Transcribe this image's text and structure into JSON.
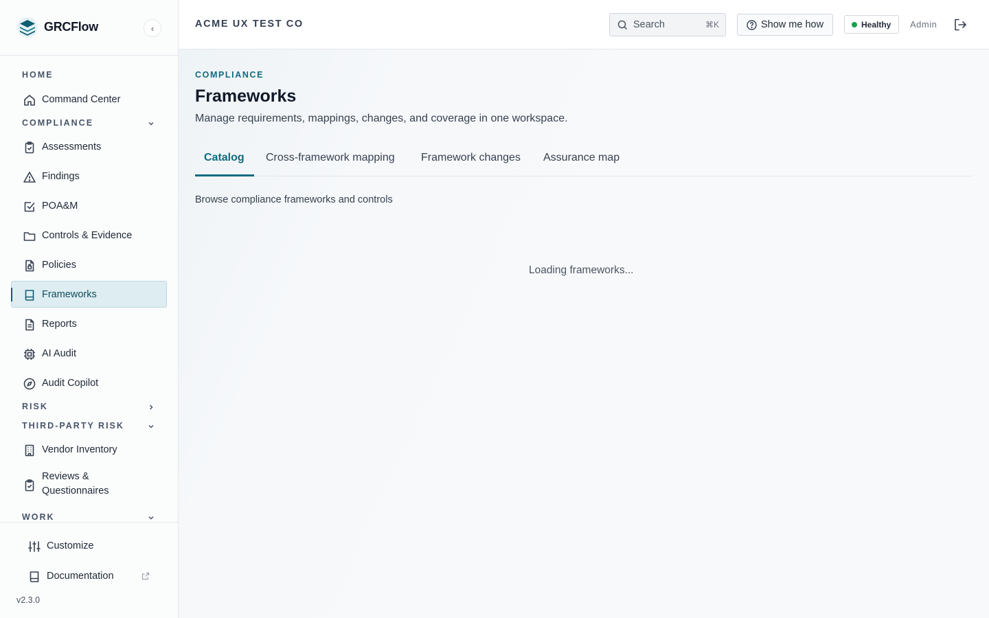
{
  "brand": {
    "name": "GRCFlow",
    "collapse_glyph": "‹",
    "logo_icon": "stack-layers-icon"
  },
  "sidebar": {
    "sections": {
      "home": "HOME",
      "compliance": "COMPLIANCE",
      "risk": "RISK",
      "third_party_risk": "THIRD-PARTY RISK",
      "work": "WORK"
    },
    "items": [
      {
        "label": "Command Center",
        "icon": "home-icon"
      },
      {
        "label": "Assessments",
        "icon": "clipboard-check-icon"
      },
      {
        "label": "Findings",
        "icon": "warning-triangle-icon"
      },
      {
        "label": "POA&M",
        "icon": "checkbox-icon"
      },
      {
        "label": "Controls & Evidence",
        "icon": "folder-icon"
      },
      {
        "label": "Policies",
        "icon": "document-lock-icon"
      },
      {
        "label": "Frameworks",
        "icon": "book-icon",
        "active": true
      },
      {
        "label": "Reports",
        "icon": "report-icon"
      },
      {
        "label": "AI Audit",
        "icon": "chip-icon"
      },
      {
        "label": "Audit Copilot",
        "icon": "compass-icon"
      },
      {
        "label": "Vendor Inventory",
        "icon": "building-icon"
      },
      {
        "label": "Reviews & Questionnaires",
        "icon": "clipboard-check-icon"
      }
    ],
    "footer": {
      "customize": "Customize",
      "documentation": "Documentation",
      "version": "v2.3.0"
    }
  },
  "header": {
    "org_name": "ACME UX TEST CO",
    "search": {
      "label": "Search",
      "shortcut": "⌘K"
    },
    "show_me_how": "Show me how",
    "status": "Healthy",
    "user_role": "Admin"
  },
  "main": {
    "eyebrow": "COMPLIANCE",
    "title": "Frameworks",
    "subtitle": "Manage requirements, mappings, changes, and coverage in one workspace.",
    "tabs": [
      {
        "label": "Catalog",
        "active": true
      },
      {
        "label": "Cross-framework mapping"
      },
      {
        "label": "Framework changes"
      },
      {
        "label": "Assurance map"
      }
    ],
    "tab_description": "Browse compliance frameworks and controls",
    "loading_text": "Loading frameworks..."
  },
  "colors": {
    "accent": "#0f6b80",
    "active_bg": "#deedf1",
    "status_green": "#16a34a"
  }
}
